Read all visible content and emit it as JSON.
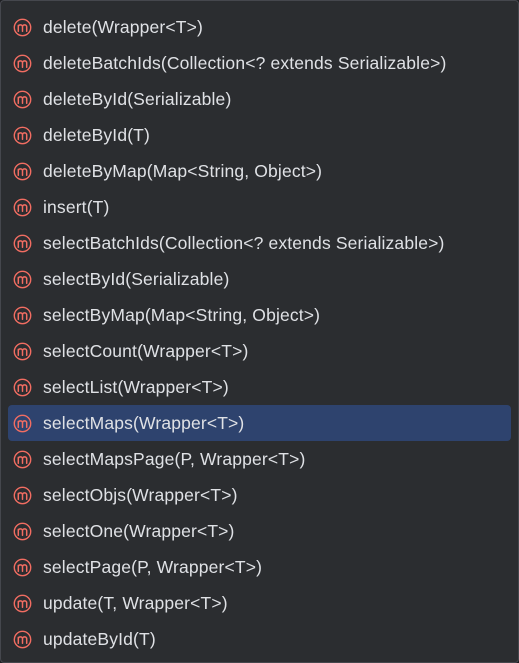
{
  "icon": {
    "name": "method-icon",
    "color": "#f26d62",
    "letter": "m"
  },
  "selected_index": 11,
  "items": [
    {
      "label": "delete(Wrapper<T>)"
    },
    {
      "label": "deleteBatchIds(Collection<? extends Serializable>)"
    },
    {
      "label": "deleteById(Serializable)"
    },
    {
      "label": "deleteById(T)"
    },
    {
      "label": "deleteByMap(Map<String, Object>)"
    },
    {
      "label": "insert(T)"
    },
    {
      "label": "selectBatchIds(Collection<? extends Serializable>)"
    },
    {
      "label": "selectById(Serializable)"
    },
    {
      "label": "selectByMap(Map<String, Object>)"
    },
    {
      "label": "selectCount(Wrapper<T>)"
    },
    {
      "label": "selectList(Wrapper<T>)"
    },
    {
      "label": "selectMaps(Wrapper<T>)"
    },
    {
      "label": "selectMapsPage(P, Wrapper<T>)"
    },
    {
      "label": "selectObjs(Wrapper<T>)"
    },
    {
      "label": "selectOne(Wrapper<T>)"
    },
    {
      "label": "selectPage(P, Wrapper<T>)"
    },
    {
      "label": "update(T, Wrapper<T>)"
    },
    {
      "label": "updateById(T)"
    }
  ]
}
